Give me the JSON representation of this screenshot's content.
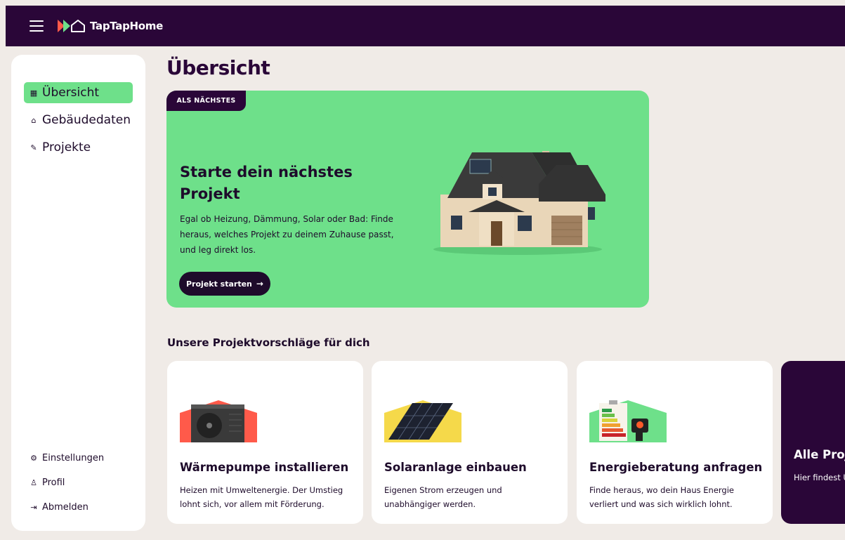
{
  "app": {
    "name": "TapTapHome"
  },
  "sidebar": {
    "items": [
      {
        "label": "Übersicht",
        "icon": "grid-icon",
        "active": true
      },
      {
        "label": "Gebäudedaten",
        "icon": "home-icon",
        "active": false
      },
      {
        "label": "Projekte",
        "icon": "wrench-icon",
        "active": false
      }
    ],
    "bottom_items": [
      {
        "label": "Einstellungen",
        "icon": "gear-icon"
      },
      {
        "label": "Profil",
        "icon": "user-icon"
      },
      {
        "label": "Abmelden",
        "icon": "logout-icon"
      }
    ]
  },
  "main": {
    "title": "Übersicht",
    "hero": {
      "badge": "ALS NÄCHSTES",
      "title": "Starte dein nächstes Projekt",
      "text": "Egal ob Heizung, Dämmung, Solar oder Bad: Finde heraus, welches Projekt zu deinem Zuhause passt, und leg direkt los.",
      "button_label": "Projekt starten",
      "button_icon": "arrow-right-icon"
    },
    "suggestions_title": "Unsere Projektvorschläge für dich",
    "cards": [
      {
        "title": "Wärmepumpe installieren",
        "text": "Heizen mit Umweltenergie. Der Umstieg lohnt sich, vor allem mit Förderung."
      },
      {
        "title": "Solaranlage einbauen",
        "text": "Eigenen Strom erzeugen und unabhängiger werden."
      },
      {
        "title": "Energieberatung anfragen",
        "text": "Finde heraus, wo dein Haus Energie verliert und was sich wirklich lohnt."
      },
      {
        "title": "Alle Proj",
        "text": "Hier findest Überblick al TapTapHome"
      }
    ]
  },
  "colors": {
    "brand_dark": "#2a0638",
    "accent_green": "#6ee08a",
    "background": "#f0ebe7"
  }
}
